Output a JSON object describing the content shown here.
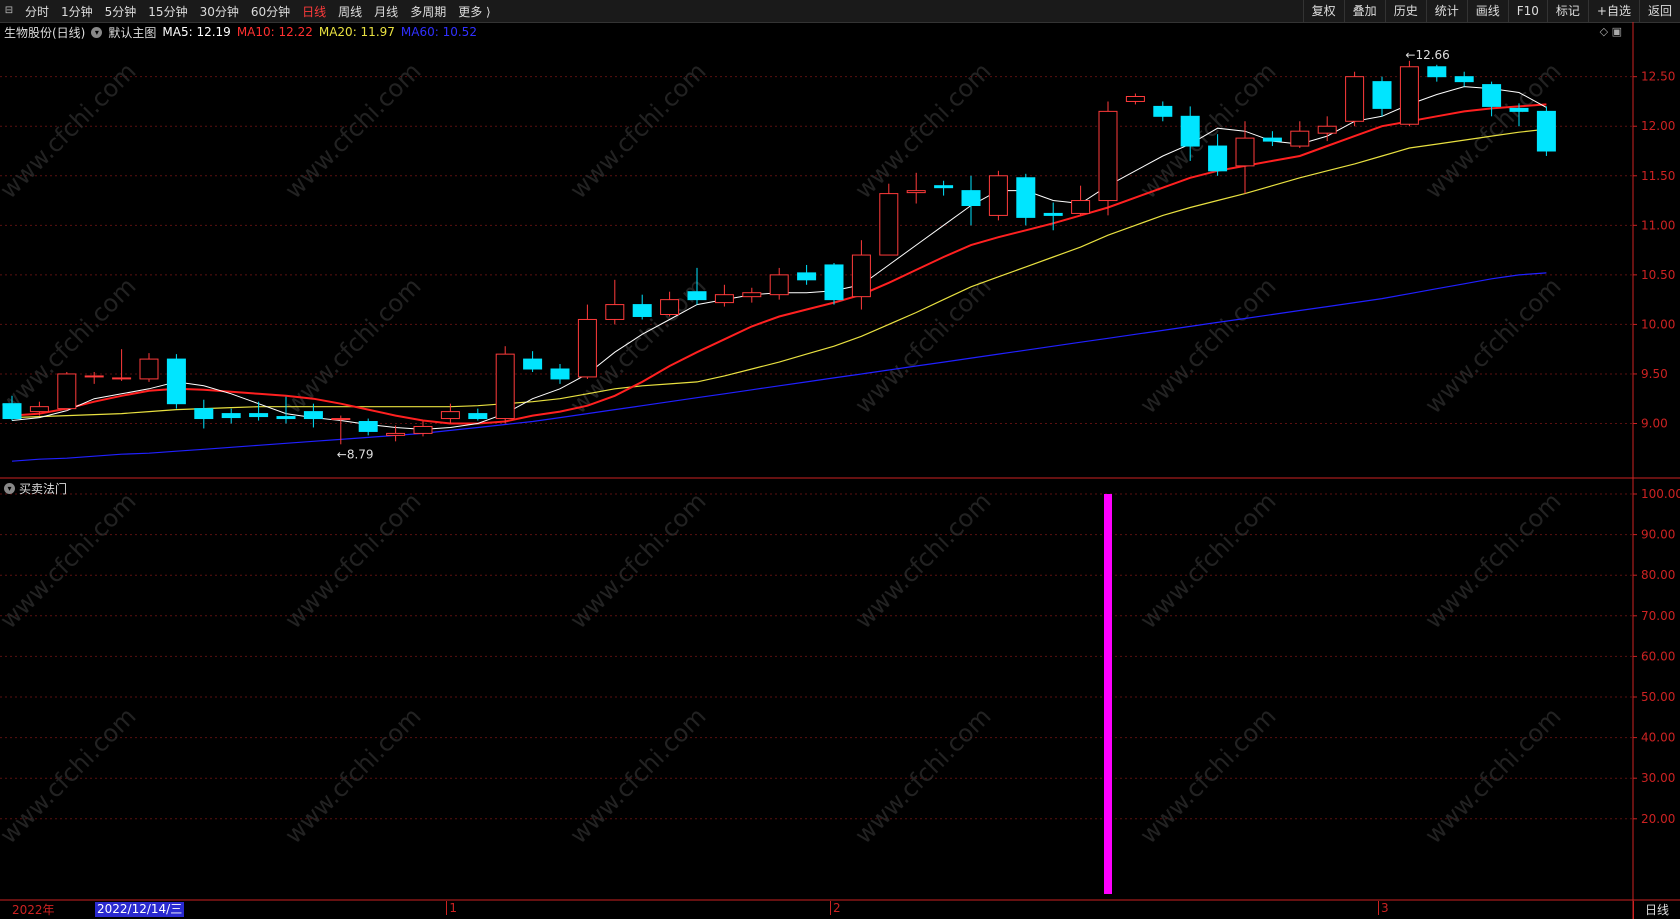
{
  "toolbar": {
    "tabs": [
      "分时",
      "1分钟",
      "5分钟",
      "15分钟",
      "30分钟",
      "60分钟",
      "日线",
      "周线",
      "月线",
      "多周期",
      "更多 ⟩"
    ],
    "active_tab": "日线",
    "right_buttons": [
      "复权",
      "叠加",
      "历史",
      "统计",
      "画线",
      "F10",
      "标记",
      "+自选",
      "返回"
    ]
  },
  "legend": {
    "stock": "生物股份(日线)",
    "template": "默认主图",
    "ma5": "MA5: 12.19",
    "ma10": "MA10: 12.22",
    "ma20": "MA20: 11.97",
    "ma60": "MA60: 10.52"
  },
  "sub_panel": {
    "title": "买卖法门"
  },
  "xaxis": {
    "year_label": "2022年",
    "cursor_date": "2022/12/14/三",
    "month_ticks": [
      "1",
      "2",
      "3"
    ],
    "period": "日线"
  },
  "colors": {
    "up": "#ff3b3b",
    "down": "#00e5ff",
    "ma5": "#ffffff",
    "ma10": "#ff2020",
    "ma20": "#e8e040",
    "ma60": "#2020ff",
    "signal": "#ff00ff",
    "axis": "#cc2222"
  },
  "chart_data": [
    {
      "type": "candlestick",
      "title": "生物股份(日线)",
      "y_ticks": [
        9.0,
        9.5,
        10.0,
        10.5,
        11.0,
        11.5,
        12.0,
        12.5
      ],
      "ylim": [
        8.45,
        12.85
      ],
      "annotations": [
        {
          "label": "←8.79",
          "index": 12
        },
        {
          "label": "←12.66",
          "index": 51
        }
      ],
      "candles": [
        [
          9.2,
          9.05,
          9.28,
          9.03
        ],
        [
          9.12,
          9.17,
          9.22,
          9.08
        ],
        [
          9.15,
          9.5,
          9.52,
          9.13
        ],
        [
          9.48,
          9.48,
          9.52,
          9.4
        ],
        [
          9.45,
          9.46,
          9.75,
          9.43
        ],
        [
          9.45,
          9.65,
          9.71,
          9.42
        ],
        [
          9.65,
          9.2,
          9.7,
          9.15
        ],
        [
          9.15,
          9.05,
          9.24,
          8.95
        ],
        [
          9.1,
          9.06,
          9.15,
          9.0
        ],
        [
          9.1,
          9.07,
          9.22,
          9.03
        ],
        [
          9.07,
          9.05,
          9.27,
          9.0
        ],
        [
          9.12,
          9.05,
          9.2,
          8.96
        ],
        [
          9.05,
          9.05,
          9.08,
          8.79
        ],
        [
          9.02,
          8.92,
          9.05,
          8.88
        ],
        [
          8.88,
          8.9,
          8.98,
          8.82
        ],
        [
          8.9,
          8.97,
          9.02,
          8.87
        ],
        [
          9.05,
          9.12,
          9.2,
          9.0
        ],
        [
          9.1,
          9.05,
          9.15,
          9.03
        ],
        [
          9.05,
          9.7,
          9.78,
          9.0
        ],
        [
          9.65,
          9.55,
          9.73,
          9.52
        ],
        [
          9.55,
          9.45,
          9.6,
          9.4
        ],
        [
          9.47,
          10.05,
          10.2,
          9.45
        ],
        [
          10.05,
          10.2,
          10.45,
          10.0
        ],
        [
          10.2,
          10.08,
          10.3,
          10.05
        ],
        [
          10.1,
          10.25,
          10.33,
          10.08
        ],
        [
          10.33,
          10.25,
          10.57,
          10.2
        ],
        [
          10.22,
          10.3,
          10.4,
          10.18
        ],
        [
          10.28,
          10.32,
          10.37,
          10.22
        ],
        [
          10.3,
          10.5,
          10.57,
          10.25
        ],
        [
          10.52,
          10.45,
          10.6,
          10.4
        ],
        [
          10.6,
          10.25,
          10.62,
          10.2
        ],
        [
          10.28,
          10.7,
          10.85,
          10.15
        ],
        [
          10.7,
          11.32,
          11.42,
          10.7
        ],
        [
          11.33,
          11.35,
          11.53,
          11.22
        ],
        [
          11.4,
          11.38,
          11.45,
          11.3
        ],
        [
          11.35,
          11.2,
          11.5,
          11.0
        ],
        [
          11.1,
          11.5,
          11.55,
          11.05
        ],
        [
          11.48,
          11.08,
          11.52,
          11.0
        ],
        [
          11.12,
          11.1,
          11.23,
          10.95
        ],
        [
          11.12,
          11.25,
          11.4,
          11.1
        ],
        [
          11.25,
          12.15,
          12.25,
          11.1
        ],
        [
          12.25,
          12.3,
          12.33,
          12.22
        ],
        [
          12.2,
          12.1,
          12.25,
          12.05
        ],
        [
          12.1,
          11.8,
          12.2,
          11.65
        ],
        [
          11.8,
          11.55,
          11.92,
          11.5
        ],
        [
          11.6,
          11.88,
          12.05,
          11.32
        ],
        [
          11.88,
          11.85,
          11.95,
          11.8
        ],
        [
          11.8,
          11.95,
          12.05,
          11.78
        ],
        [
          11.93,
          12.0,
          12.1,
          11.85
        ],
        [
          12.05,
          12.5,
          12.55,
          12.0
        ],
        [
          12.45,
          12.18,
          12.5,
          12.1
        ],
        [
          12.02,
          12.6,
          12.66,
          12.0
        ],
        [
          12.6,
          12.5,
          12.62,
          12.45
        ],
        [
          12.5,
          12.45,
          12.55,
          12.4
        ],
        [
          12.42,
          12.2,
          12.45,
          12.1
        ],
        [
          12.18,
          12.15,
          12.23,
          12.0
        ],
        [
          12.15,
          11.75,
          12.2,
          11.7
        ]
      ],
      "ma5": [
        9.03,
        9.06,
        9.13,
        9.25,
        9.3,
        9.35,
        9.42,
        9.38,
        9.3,
        9.2,
        9.1,
        9.06,
        9.03,
        8.99,
        8.96,
        8.94,
        8.96,
        9.0,
        9.1,
        9.25,
        9.35,
        9.5,
        9.72,
        9.9,
        10.05,
        10.2,
        10.25,
        10.3,
        10.32,
        10.32,
        10.34,
        10.4,
        10.6,
        10.8,
        11.0,
        11.2,
        11.35,
        11.35,
        11.25,
        11.22,
        11.4,
        11.55,
        11.7,
        11.82,
        11.98,
        11.95,
        11.85,
        11.82,
        11.9,
        12.05,
        12.1,
        12.22,
        12.32,
        12.4,
        12.38,
        12.34,
        12.19
      ],
      "ma10": [
        9.08,
        9.1,
        9.15,
        9.22,
        9.28,
        9.33,
        9.35,
        9.34,
        9.32,
        9.3,
        9.28,
        9.25,
        9.2,
        9.14,
        9.08,
        9.03,
        9.0,
        9.0,
        9.02,
        9.08,
        9.12,
        9.18,
        9.28,
        9.42,
        9.58,
        9.72,
        9.85,
        9.98,
        10.08,
        10.15,
        10.22,
        10.3,
        10.42,
        10.55,
        10.68,
        10.8,
        10.88,
        10.95,
        11.02,
        11.1,
        11.18,
        11.28,
        11.38,
        11.48,
        11.55,
        11.6,
        11.65,
        11.7,
        11.8,
        11.9,
        12.0,
        12.05,
        12.1,
        12.15,
        12.18,
        12.2,
        12.22
      ],
      "ma20": [
        9.06,
        9.07,
        9.08,
        9.09,
        9.1,
        9.12,
        9.14,
        9.15,
        9.16,
        9.17,
        9.17,
        9.17,
        9.17,
        9.17,
        9.17,
        9.17,
        9.17,
        9.18,
        9.2,
        9.22,
        9.25,
        9.3,
        9.35,
        9.38,
        9.4,
        9.42,
        9.48,
        9.55,
        9.62,
        9.7,
        9.78,
        9.88,
        10.0,
        10.12,
        10.25,
        10.38,
        10.48,
        10.58,
        10.68,
        10.78,
        10.9,
        11.0,
        11.1,
        11.18,
        11.25,
        11.32,
        11.4,
        11.48,
        11.55,
        11.62,
        11.7,
        11.78,
        11.82,
        11.86,
        11.9,
        11.94,
        11.97
      ],
      "ma60": [
        8.62,
        8.64,
        8.65,
        8.67,
        8.69,
        8.7,
        8.72,
        8.74,
        8.76,
        8.78,
        8.8,
        8.82,
        8.84,
        8.86,
        8.88,
        8.9,
        8.93,
        8.96,
        8.99,
        9.02,
        9.06,
        9.1,
        9.14,
        9.18,
        9.22,
        9.26,
        9.3,
        9.34,
        9.38,
        9.42,
        9.46,
        9.5,
        9.54,
        9.58,
        9.62,
        9.66,
        9.7,
        9.74,
        9.78,
        9.82,
        9.86,
        9.9,
        9.94,
        9.98,
        10.02,
        10.06,
        10.1,
        10.14,
        10.18,
        10.22,
        10.26,
        10.31,
        10.36,
        10.41,
        10.46,
        10.5,
        10.52
      ]
    },
    {
      "type": "bar",
      "title": "买卖法门",
      "y_ticks": [
        20.0,
        30.0,
        40.0,
        50.0,
        60.0,
        70.0,
        80.0,
        90.0,
        100.0
      ],
      "ylim": [
        0,
        100
      ],
      "signals": [
        {
          "index": 40,
          "value": 100
        }
      ]
    }
  ]
}
